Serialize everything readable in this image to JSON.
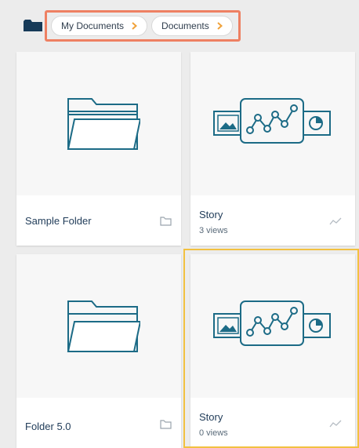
{
  "breadcrumb": {
    "items": [
      {
        "label": "My Documents"
      },
      {
        "label": "Documents"
      }
    ]
  },
  "cards": [
    {
      "title": "Sample Folder",
      "type_icon": "folder-icon"
    },
    {
      "title": "Story",
      "subtitle": "3 views",
      "type_icon": "trend-line-icon"
    },
    {
      "title": "Folder 5.0",
      "type_icon": "folder-icon"
    },
    {
      "title": "Story",
      "subtitle": "0 views",
      "type_icon": "trend-line-icon"
    }
  ],
  "colors": {
    "breadcrumb_border": "#ee8062",
    "chevron": "#f0a23a",
    "selected_border": "#f2c140",
    "icon_teal": "#1c6b86"
  }
}
